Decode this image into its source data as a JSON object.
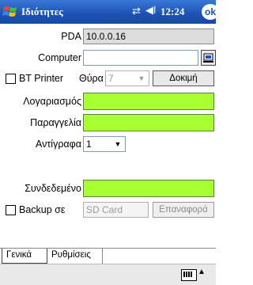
{
  "titlebar": {
    "title": "Ιδιότητες",
    "time": "12:24",
    "ok": "ok"
  },
  "pda": {
    "label": "PDA",
    "value": "10.0.0.16"
  },
  "computer": {
    "label": "Computer",
    "value": ""
  },
  "bt_printer": {
    "label": "BT Printer",
    "port_label": "Θύρα",
    "port_value": "7",
    "test_button": "Δοκιμή"
  },
  "account": {
    "label": "Λογαριασμός",
    "value": ""
  },
  "order": {
    "label": "Παραγγελία",
    "value": ""
  },
  "copies": {
    "label": "Αντίγραφα",
    "value": "1"
  },
  "connected": {
    "label": "Συνδεδεμένο",
    "value": ""
  },
  "backup": {
    "label": "Backup σε",
    "placeholder": "SD Card",
    "restore_button": "Επαναφορά"
  },
  "tabs": [
    {
      "label": "Γενικά"
    },
    {
      "label": "Ρυθμίσεις"
    }
  ],
  "colors": {
    "titlebar": "#1c52b4",
    "highlight_field": "#a8ff32"
  }
}
